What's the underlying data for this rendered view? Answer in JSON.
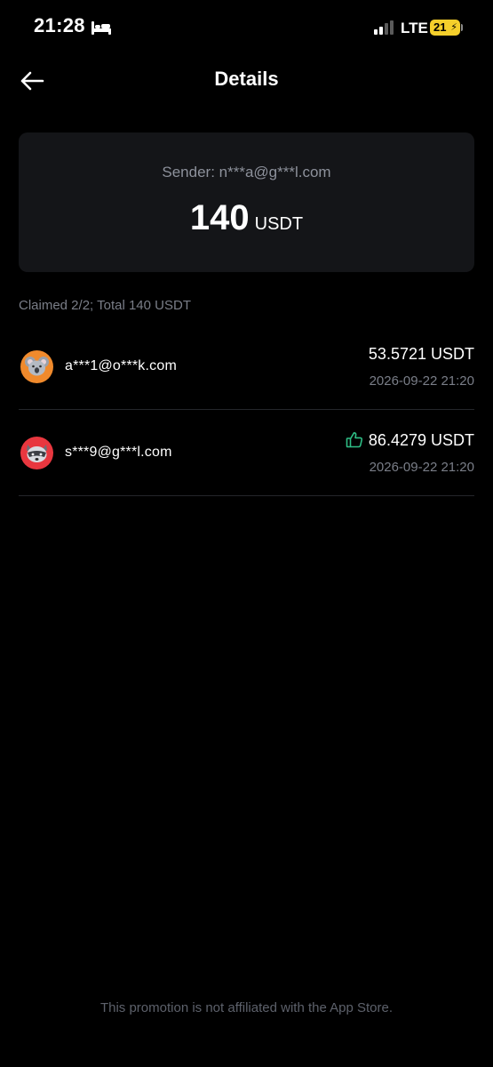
{
  "status_bar": {
    "time": "21:28",
    "network": "LTE",
    "battery": "21"
  },
  "header": {
    "title": "Details"
  },
  "summary": {
    "sender": "Sender: n***a@g***l.com",
    "amount": "140",
    "unit": "USDT"
  },
  "claimed_summary": "Claimed 2/2; Total 140 USDT",
  "claims": [
    {
      "email": "a***1@o***k.com",
      "amount": "53.5721 USDT",
      "time": "2026-09-22 21:20",
      "avatar": "koala",
      "best": false
    },
    {
      "email": "s***9@g***l.com",
      "amount": "86.4279 USDT",
      "time": "2026-09-22 21:20",
      "avatar": "raccoon",
      "best": true
    }
  ],
  "footer": "This promotion is not affiliated with the App Store.",
  "colors": {
    "background": "#000000",
    "card": "#141518",
    "secondary_text": "#7a7e88",
    "best_luck_green": "#2ebd85",
    "battery": "#f5cf2b",
    "koala_avatar": "#f08a2c",
    "raccoon_avatar": "#e8373f"
  },
  "icons": {
    "back": "arrow-left-icon",
    "sleep": "bed-icon",
    "signal": "cellular-signal-icon",
    "best": "thumbs-up-icon"
  }
}
